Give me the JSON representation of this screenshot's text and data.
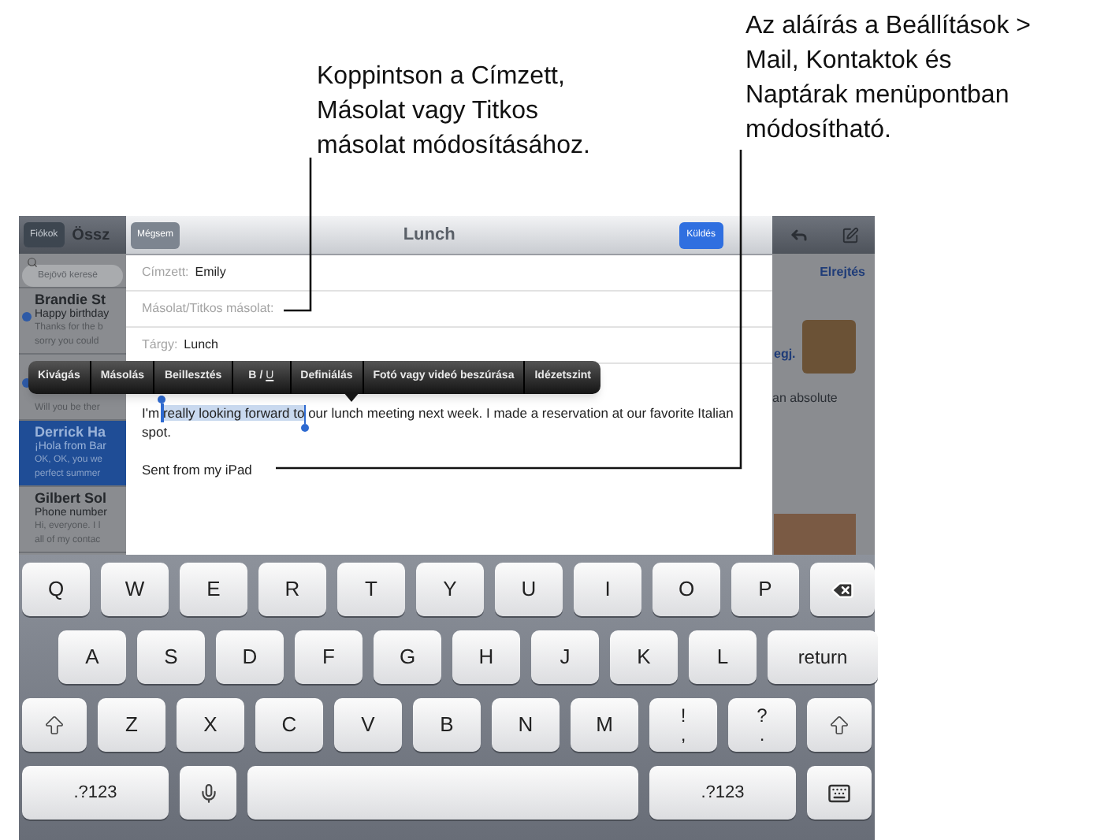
{
  "callouts": [
    {
      "lines": [
        "Koppintson a Címzett,",
        "Másolat vagy Titkos",
        "másolat módosításához."
      ]
    },
    {
      "lines": [
        "Az aláírás a Beállítások >",
        "Mail, Kontaktok és",
        "Naptárak menüpontban",
        "módosítható."
      ]
    }
  ],
  "mail_app": {
    "back_button": "Fiókok",
    "title": "Össz",
    "search": {
      "placeholder": "Bejövő keresé"
    },
    "messages": [
      {
        "sender": "Brandie St",
        "subject": "Happy birthday",
        "preview": [
          "Thanks for the b",
          "sorry you could"
        ],
        "unread": true,
        "selected": false
      },
      {
        "preview": [
          "Will you be ther"
        ],
        "unread": true,
        "selected": false
      },
      {
        "sender": "Derrick Ha",
        "subject": "¡Hola from Bar",
        "preview": [
          "OK, OK, you we",
          "perfect summer"
        ],
        "unread": false,
        "selected": true
      },
      {
        "sender": "Gilbert Sol",
        "subject": "Phone number",
        "preview": [
          "Hi, everyone. I l",
          "all of my contac"
        ],
        "unread": false,
        "selected": false
      }
    ],
    "reading": {
      "hide_link": "Elrejtés",
      "link_fragment": "egj.",
      "text_fragment": "an absolute"
    }
  },
  "compose": {
    "cancel": "Mégsem",
    "title": "Lunch",
    "send": "Küldés",
    "fields": [
      {
        "label": "Címzett:",
        "value": "Emily"
      },
      {
        "label": "Másolat/Titkos másolat:"
      },
      {
        "label": "Tárgy:",
        "value": "Lunch"
      }
    ],
    "body": {
      "before": "I'm ",
      "selected": "really looking forward to",
      "after": " our lunch meeting next week. I made a reservation at our favorite Italian spot."
    },
    "signature": "Sent from my iPad"
  },
  "edit_menu": [
    {
      "kind": "text",
      "label": "Kivágás"
    },
    {
      "kind": "text",
      "label": "Másolás"
    },
    {
      "kind": "text",
      "label": "Beillesztés"
    },
    {
      "kind": "format",
      "bold": "B",
      "separator": "/",
      "underline": "U"
    },
    {
      "kind": "text",
      "label": "Definiálás"
    },
    {
      "kind": "text",
      "label": "Fotó vagy videó beszúrása"
    },
    {
      "kind": "text",
      "label": "Idézetszint"
    }
  ],
  "keyboard": [
    [
      {
        "kind": "letter",
        "label": "Q"
      },
      {
        "kind": "letter",
        "label": "W"
      },
      {
        "kind": "letter",
        "label": "E"
      },
      {
        "kind": "letter",
        "label": "R"
      },
      {
        "kind": "letter",
        "label": "T"
      },
      {
        "kind": "letter",
        "label": "Y"
      },
      {
        "kind": "letter",
        "label": "U"
      },
      {
        "kind": "letter",
        "label": "I"
      },
      {
        "kind": "letter",
        "label": "O"
      },
      {
        "kind": "letter",
        "label": "P"
      },
      {
        "kind": "backspace"
      }
    ],
    [
      {
        "kind": "letter",
        "label": "A"
      },
      {
        "kind": "letter",
        "label": "S"
      },
      {
        "kind": "letter",
        "label": "D"
      },
      {
        "kind": "letter",
        "label": "F"
      },
      {
        "kind": "letter",
        "label": "G"
      },
      {
        "kind": "letter",
        "label": "H"
      },
      {
        "kind": "letter",
        "label": "J"
      },
      {
        "kind": "letter",
        "label": "K"
      },
      {
        "kind": "letter",
        "label": "L"
      },
      {
        "kind": "return",
        "label": "return"
      }
    ],
    [
      {
        "kind": "shift"
      },
      {
        "kind": "letter",
        "label": "Z"
      },
      {
        "kind": "letter",
        "label": "X"
      },
      {
        "kind": "letter",
        "label": "C"
      },
      {
        "kind": "letter",
        "label": "V"
      },
      {
        "kind": "letter",
        "label": "B"
      },
      {
        "kind": "letter",
        "label": "N"
      },
      {
        "kind": "letter",
        "label": "M"
      },
      {
        "kind": "punct",
        "top": "!",
        "bottom": ","
      },
      {
        "kind": "punct",
        "top": "?",
        "bottom": "."
      },
      {
        "kind": "shift"
      }
    ],
    [
      {
        "kind": "numbers",
        "label": ".?123"
      },
      {
        "kind": "mic"
      },
      {
        "kind": "space"
      },
      {
        "kind": "numbers",
        "label": ".?123"
      },
      {
        "kind": "hide"
      }
    ]
  ]
}
